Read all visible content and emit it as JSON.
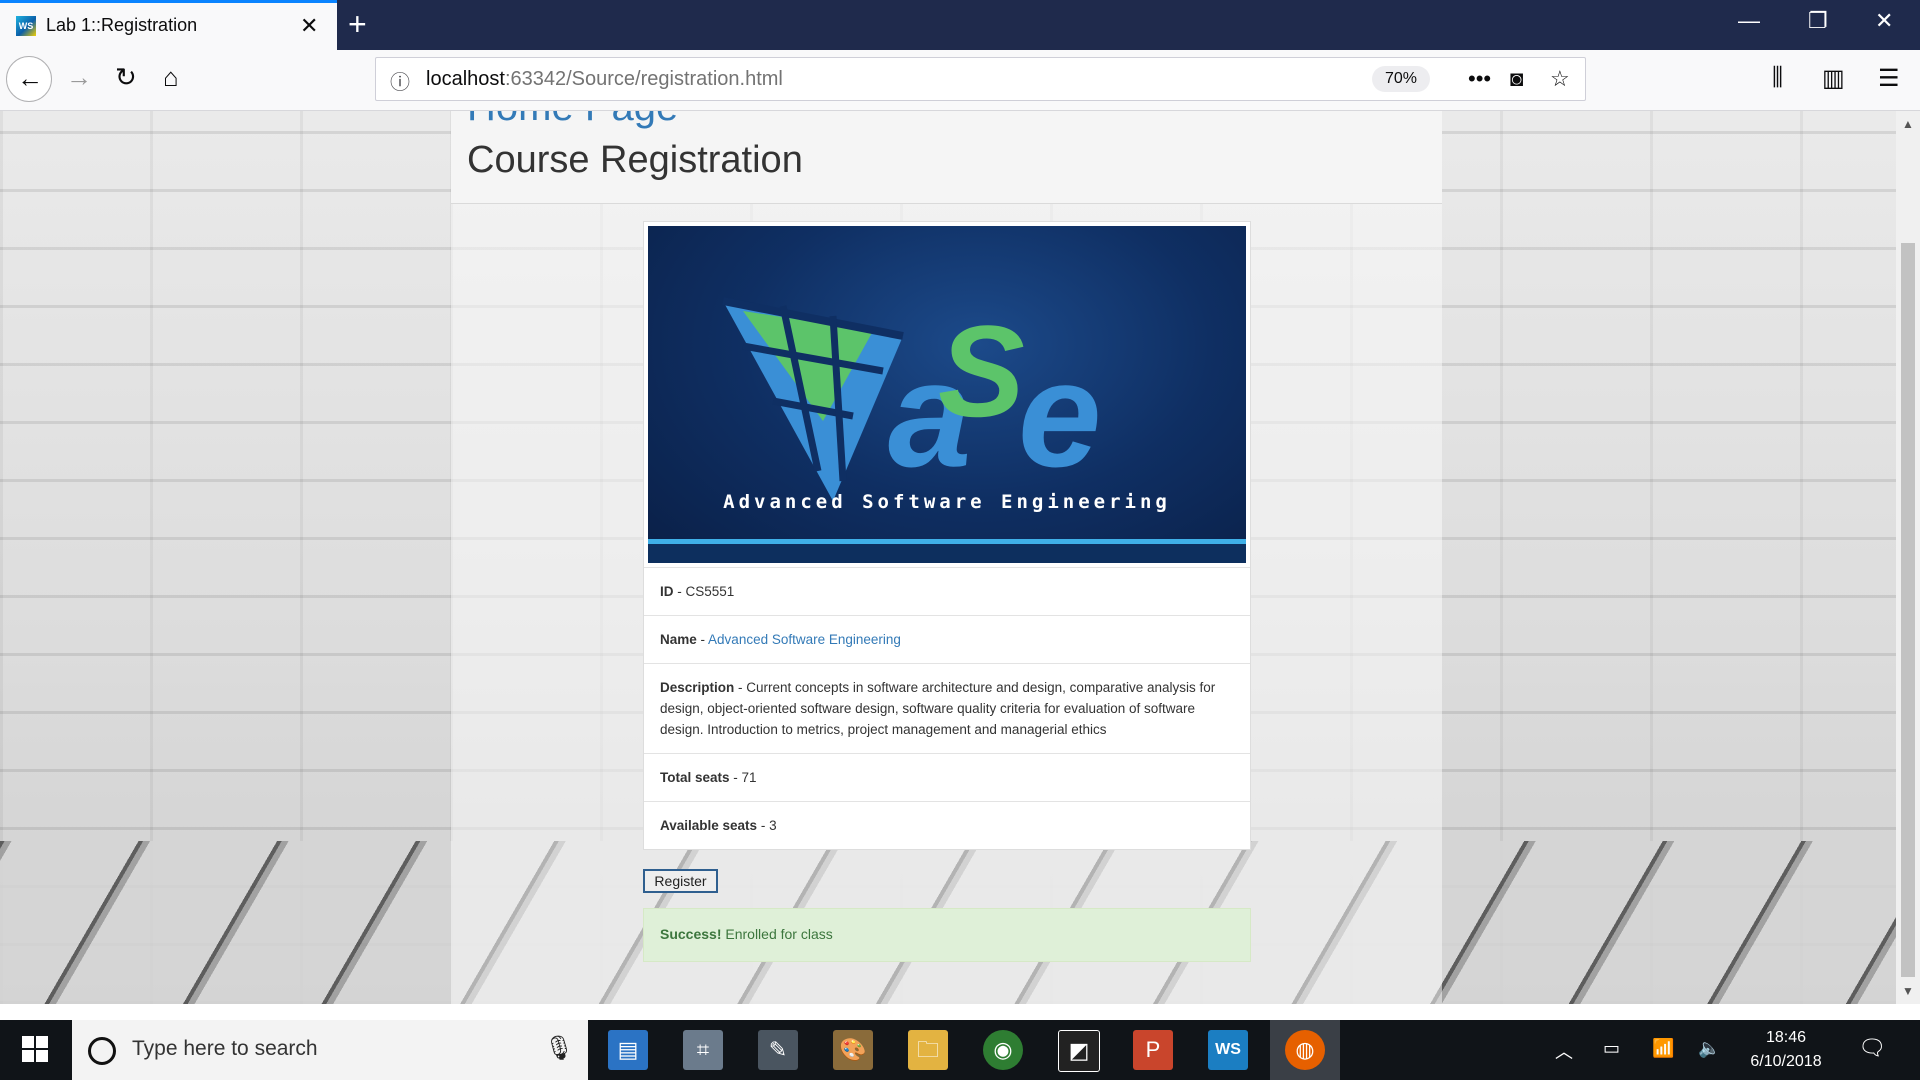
{
  "browser": {
    "tab_title": "Lab 1::Registration",
    "favicon_text": "WS",
    "url_host": "localhost",
    "url_rest": ":63342/Source/registration.html",
    "zoom": "70%"
  },
  "page": {
    "home_link_peek": "Home Page",
    "title": "Course Registration",
    "banner_caption": "Advanced Software Engineering",
    "course": {
      "id_label": "ID",
      "id_value": "CS5551",
      "name_label": "Name",
      "name_value": "Advanced Software Engineering",
      "description_label": "Description",
      "description_value": "Current concepts in software architecture and design, comparative analysis for design, object-oriented software design, software quality criteria for evaluation of software design. Introduction to metrics, project management and managerial ethics",
      "total_seats_label": "Total seats",
      "total_seats_value": "71",
      "available_seats_label": "Available seats",
      "available_seats_value": "3"
    },
    "register_button": "Register",
    "alert": {
      "strong": "Success!",
      "message": "Enrolled for class"
    }
  },
  "taskbar": {
    "search_placeholder": "Type here to search",
    "time": "18:46",
    "date": "6/10/2018"
  },
  "colors": {
    "accent": "#0a84ff",
    "link": "#337ab7",
    "success_bg": "#dff0d8",
    "success_text": "#3c763d",
    "tabbar": "#1f2a4c"
  }
}
